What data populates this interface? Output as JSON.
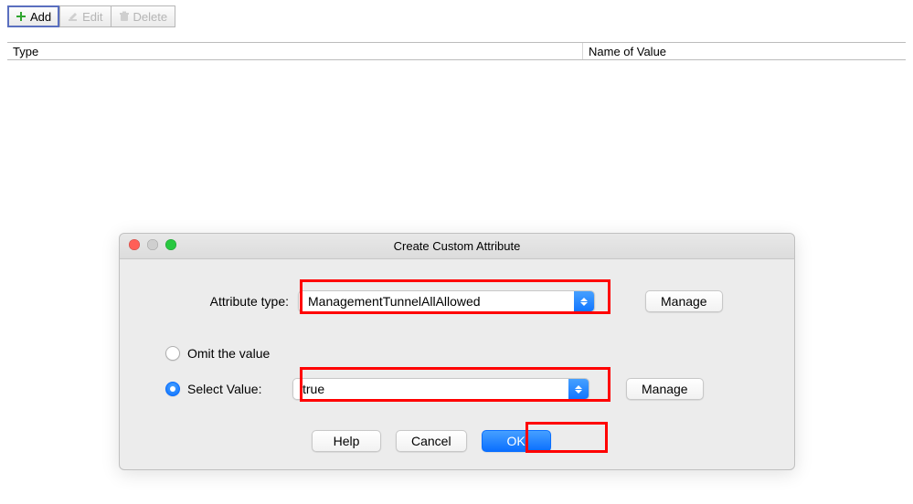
{
  "toolbar": {
    "add_label": "Add",
    "edit_label": "Edit",
    "delete_label": "Delete"
  },
  "table": {
    "headers": {
      "type": "Type",
      "name_of_value": "Name of Value"
    }
  },
  "dialog": {
    "title": "Create Custom Attribute",
    "attribute_type_label": "Attribute type:",
    "attribute_type_value": "ManagementTunnelAllAllowed",
    "manage_label": "Manage",
    "omit_label": "Omit the value",
    "select_value_label": "Select Value:",
    "select_value_value": "true",
    "radio_selected": "select",
    "buttons": {
      "help": "Help",
      "cancel": "Cancel",
      "ok": "OK"
    }
  },
  "colors": {
    "accent": "#0a6fff",
    "highlight": "#ff0000"
  }
}
